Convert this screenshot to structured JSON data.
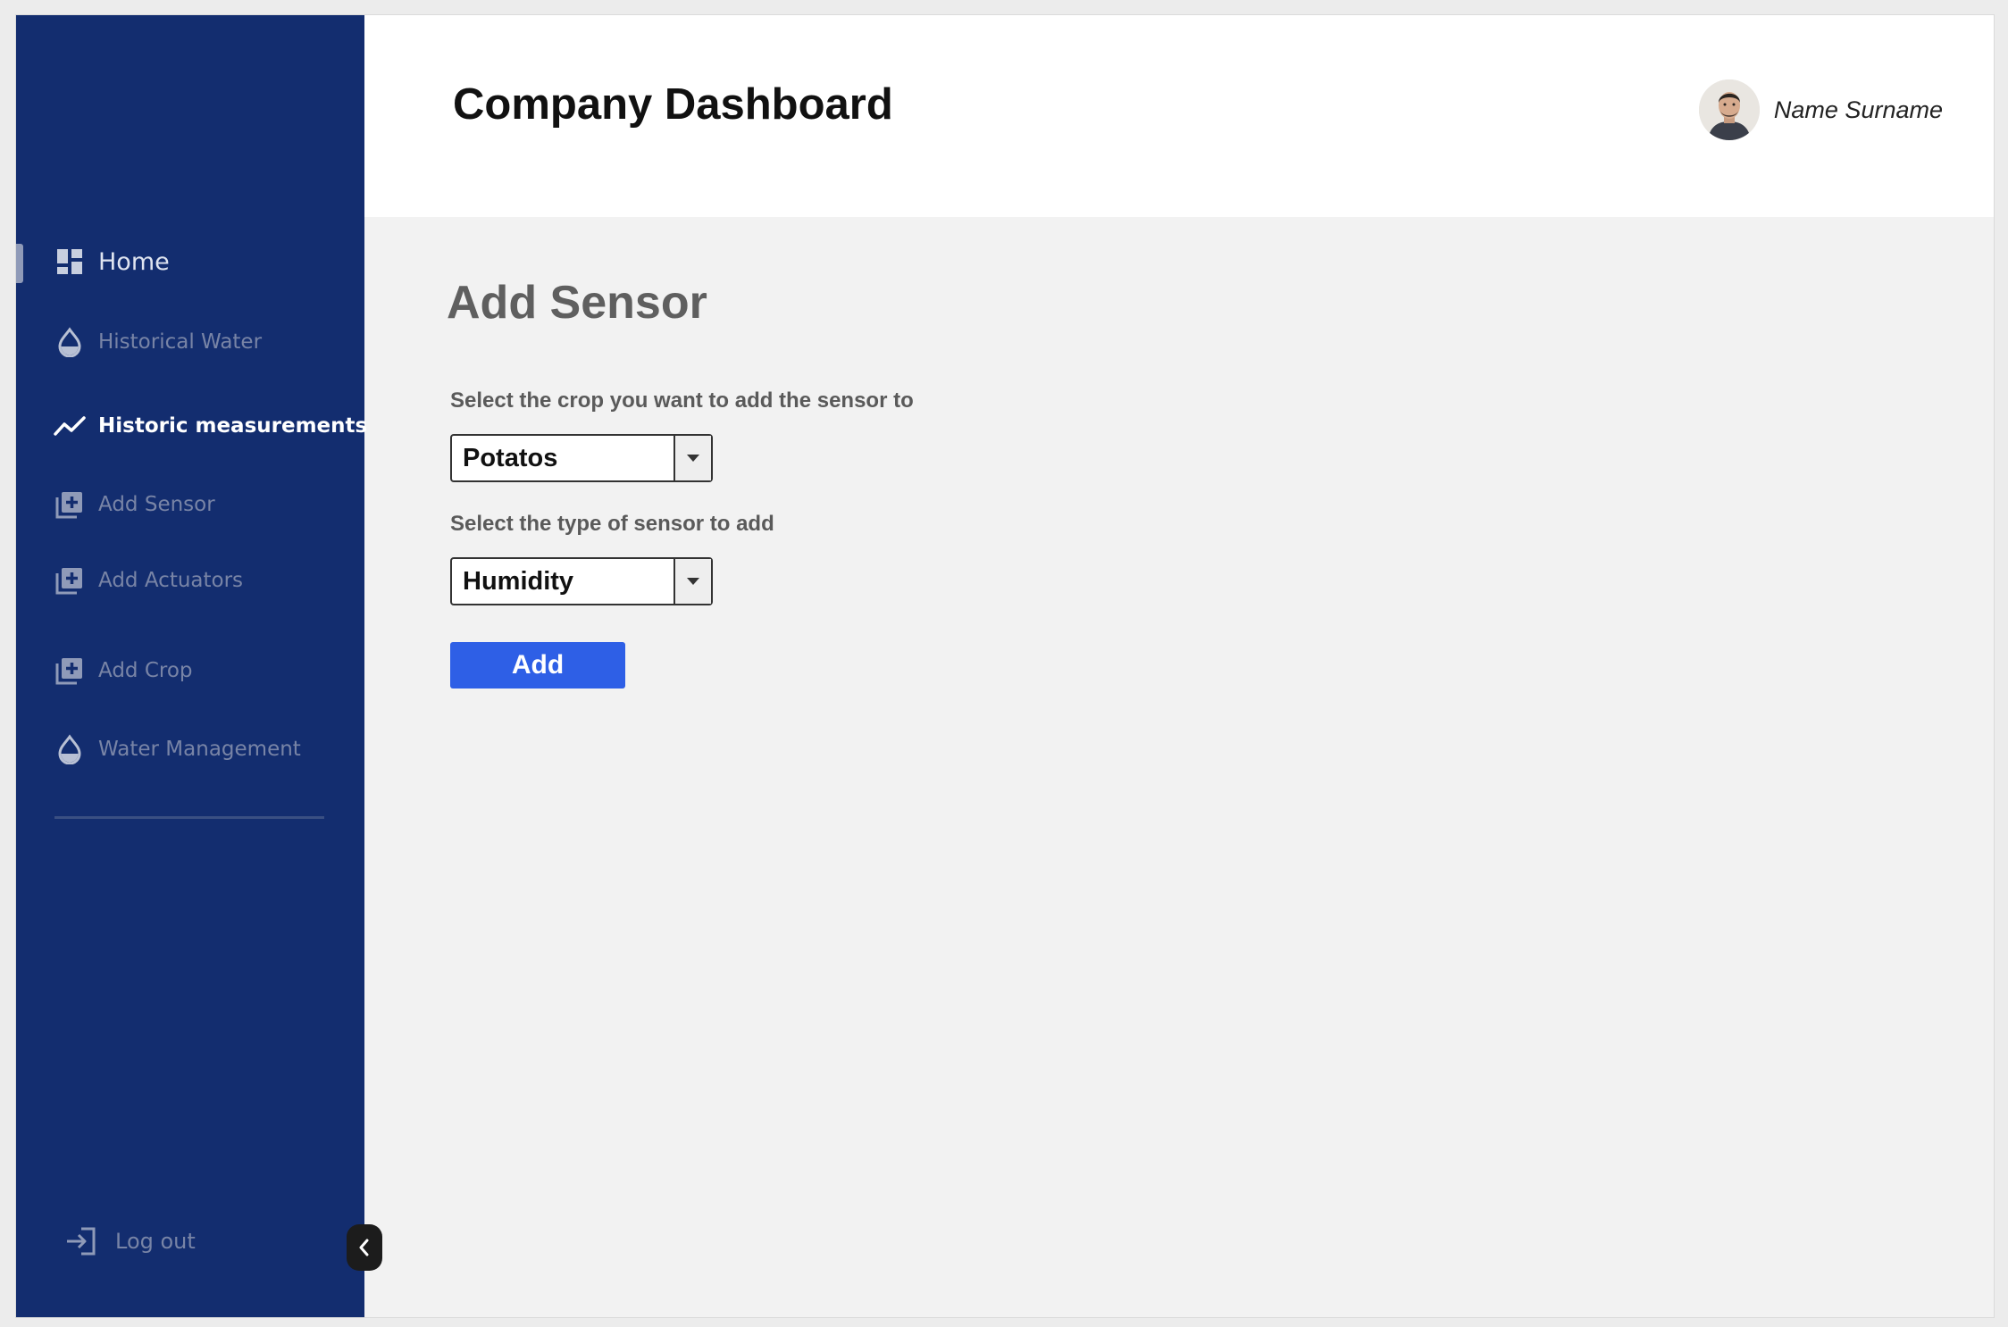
{
  "header": {
    "title": "Company Dashboard",
    "user_name": "Name Surname"
  },
  "sidebar": {
    "items": [
      {
        "label": "Home",
        "icon": "dashboard-icon"
      },
      {
        "label": "Historical Water",
        "icon": "water-drop-icon"
      },
      {
        "label": "Historic measurements",
        "icon": "trend-line-icon"
      },
      {
        "label": "Add Sensor",
        "icon": "add-box-icon"
      },
      {
        "label": "Add Actuators",
        "icon": "add-box-icon"
      },
      {
        "label": "Add Crop",
        "icon": "add-box-icon"
      },
      {
        "label": "Water Management",
        "icon": "water-drop-icon"
      }
    ],
    "logout_label": "Log out",
    "logout_icon": "login-arrow-icon",
    "collapse_icon": "chevron-left-icon"
  },
  "main": {
    "title": "Add Sensor",
    "crop_label": "Select the crop you want to add the sensor to",
    "crop_value": "Potatos",
    "sensor_type_label": "Select the type of sensor to add",
    "sensor_type_value": "Humidity",
    "add_button_label": "Add"
  },
  "colors": {
    "sidebar_bg": "#132d6f",
    "content_bg": "#f2f2f2",
    "accent_button": "#2e5fe6",
    "header_bg": "#ffffff"
  }
}
